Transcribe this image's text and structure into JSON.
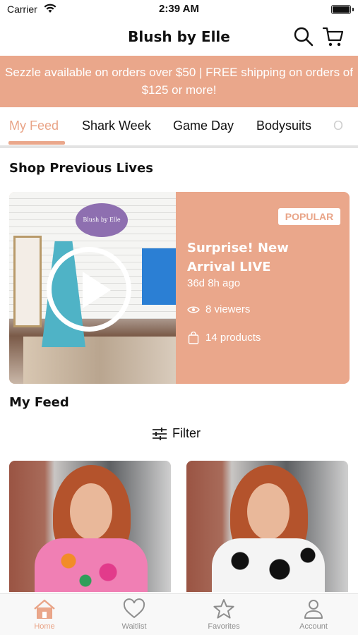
{
  "status_bar": {
    "carrier": "Carrier",
    "time": "2:39 AM"
  },
  "header": {
    "title": "Blush by Elle",
    "search_icon": "search-icon",
    "cart_icon": "cart-icon"
  },
  "promo": {
    "text": "Sezzle available on orders over $50 | FREE shipping on orders of $125 or more!"
  },
  "tabs": [
    {
      "label": "My Feed",
      "active": true
    },
    {
      "label": "Shark Week",
      "active": false
    },
    {
      "label": "Game Day",
      "active": false
    },
    {
      "label": "Bodysuits",
      "active": false
    },
    {
      "label": "O",
      "active": false
    }
  ],
  "previous_lives": {
    "title": "Shop Previous Lives",
    "card": {
      "badge": "POPULAR",
      "title": "Surprise! New Arrival LIVE",
      "time_ago": "36d 8h ago",
      "viewers": "8 viewers",
      "products": "14 products",
      "sign_text": "Blush by Elle"
    }
  },
  "feed": {
    "title": "My Feed",
    "filter_label": "Filter"
  },
  "tabbar": [
    {
      "label": "Home",
      "icon": "home-icon",
      "active": true
    },
    {
      "label": "Waitlist",
      "icon": "heart-icon",
      "active": false
    },
    {
      "label": "Favorites",
      "icon": "star-icon",
      "active": false
    },
    {
      "label": "Account",
      "icon": "person-icon",
      "active": false
    }
  ],
  "colors": {
    "accent": "#eaa78b",
    "accent_text": "#e9a487",
    "inactive": "#8e8e8e"
  }
}
